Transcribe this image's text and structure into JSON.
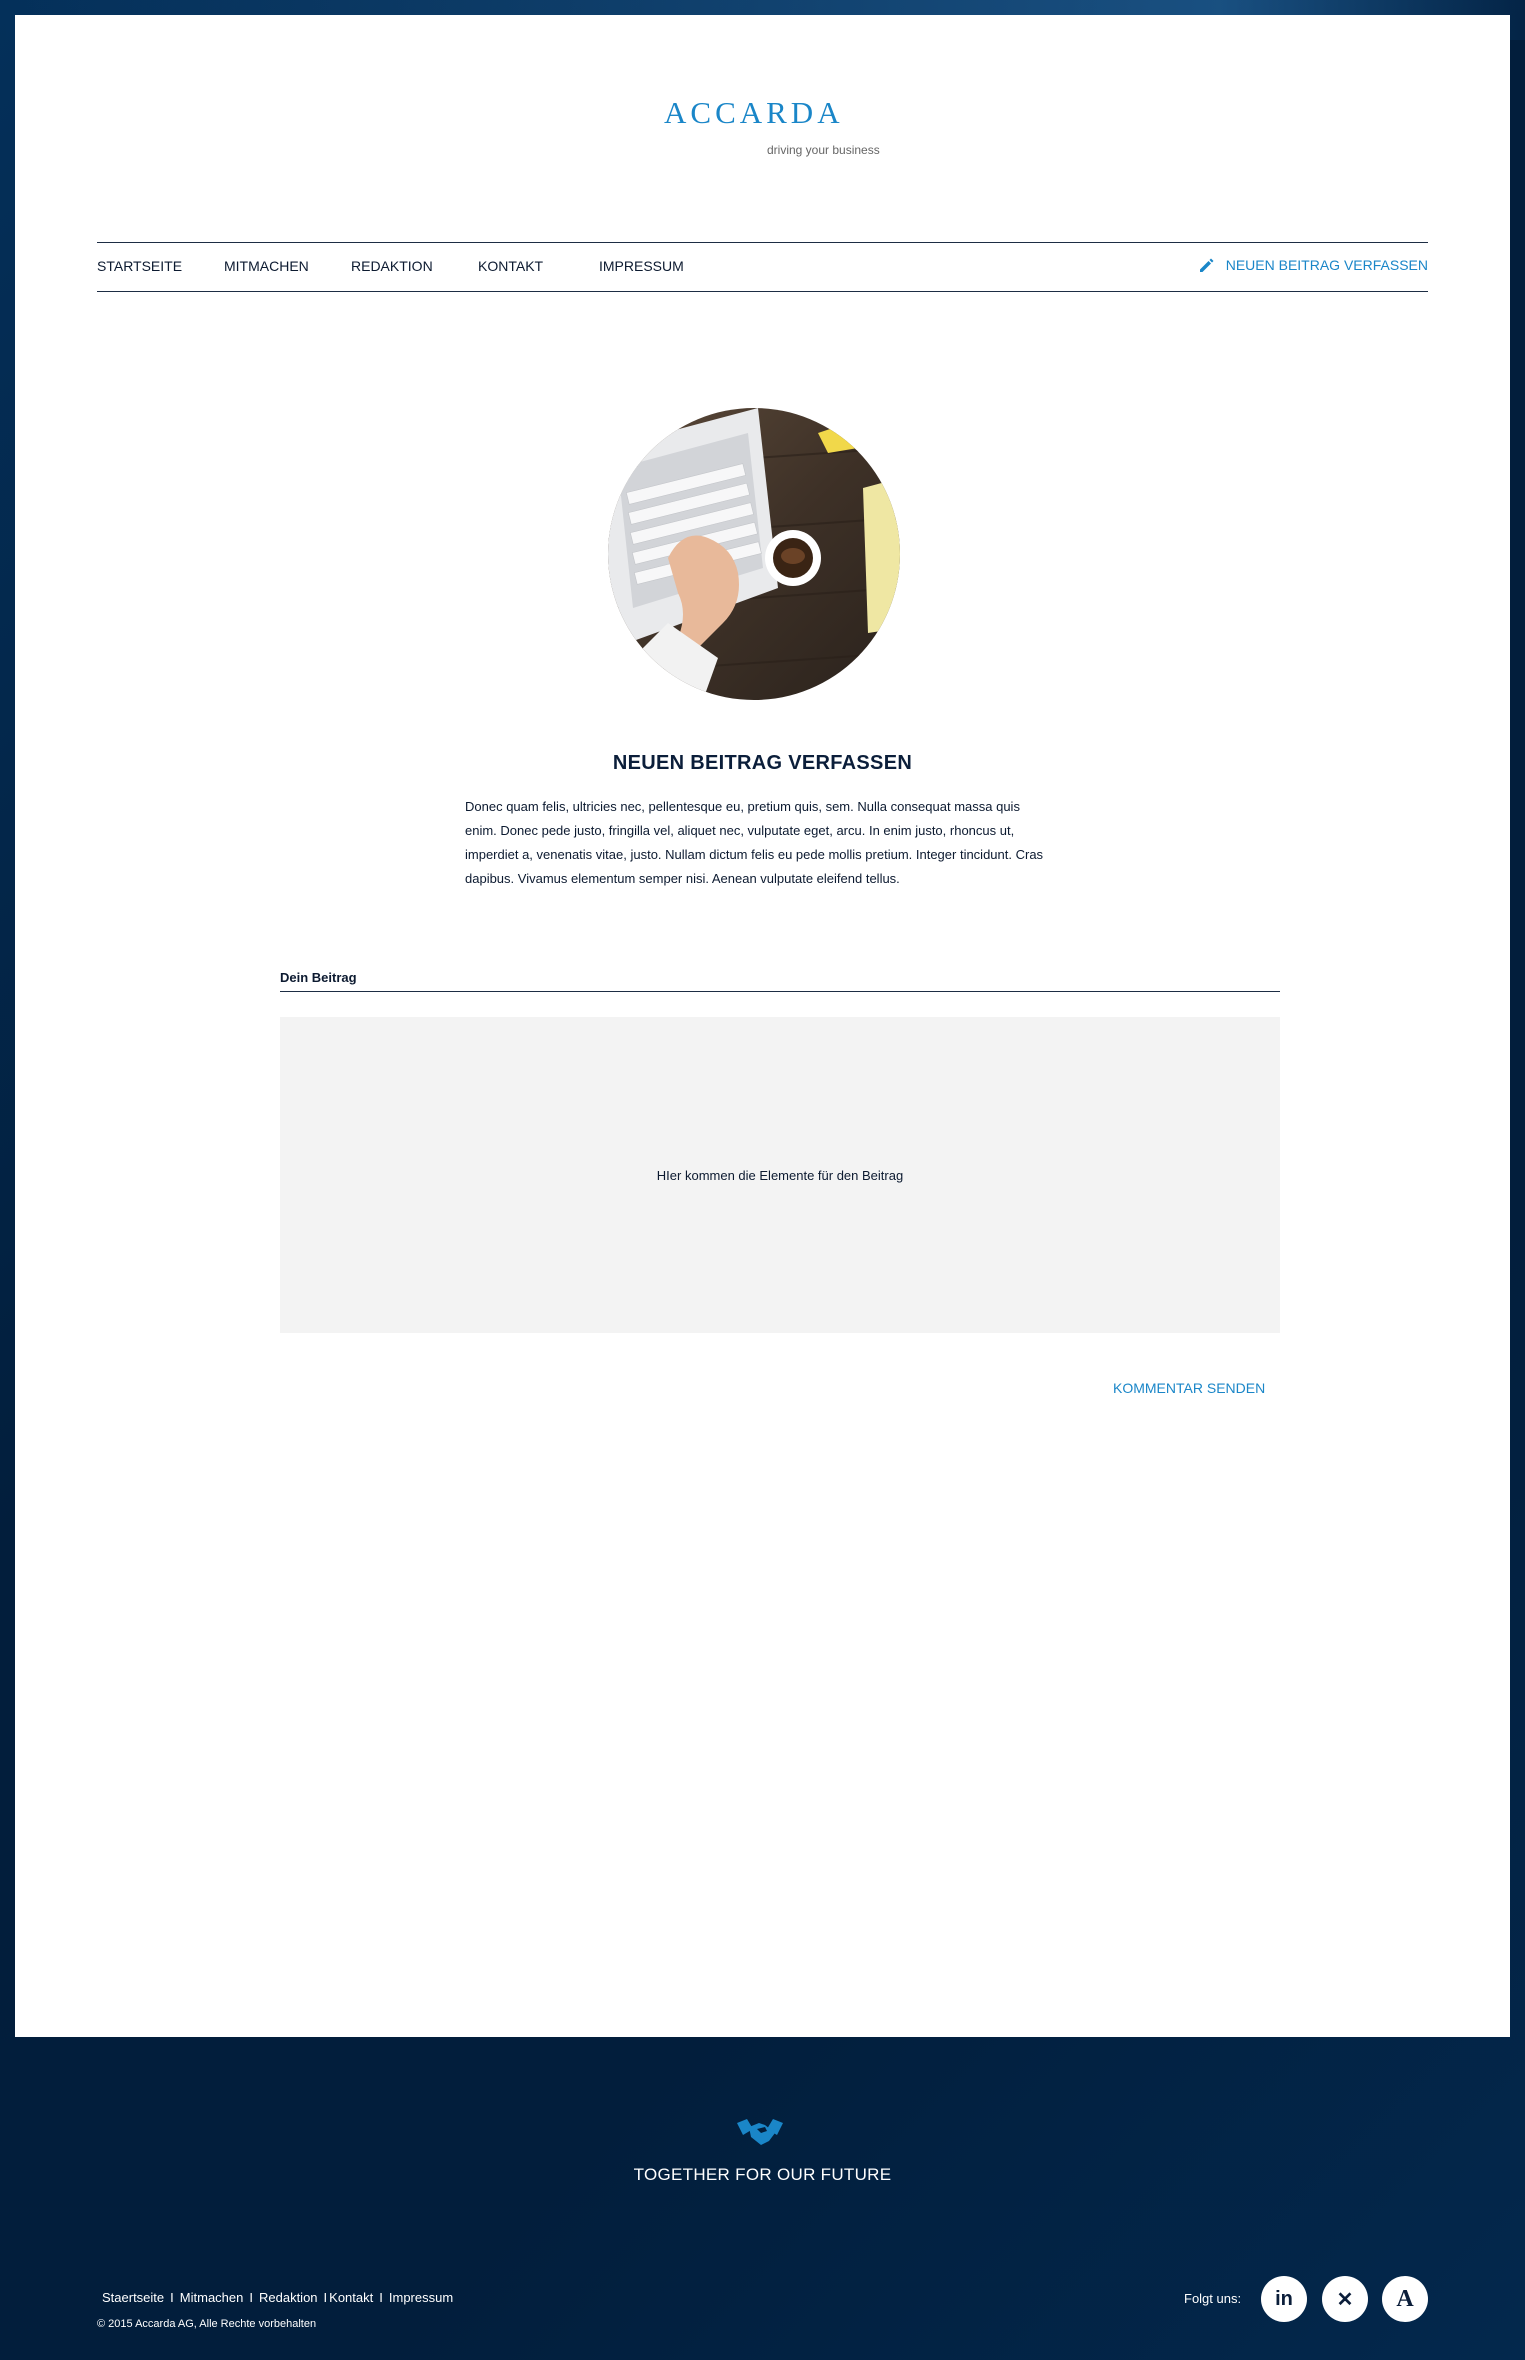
{
  "brand": {
    "name": "ACCARDA",
    "tagline": "driving your business"
  },
  "nav": {
    "items": [
      {
        "label": "STARTSEITE"
      },
      {
        "label": "MITMACHEN"
      },
      {
        "label": "REDAKTION"
      },
      {
        "label": "KONTAKT"
      },
      {
        "label": "IMPRESSUM"
      }
    ],
    "cta_label": "NEUEN BEITRAG VERFASSEN"
  },
  "main": {
    "title": "NEUEN BEITRAG VERFASSEN",
    "intro": "Donec quam felis, ultricies nec, pellentesque eu, pretium quis, sem. Nulla consequat massa quis enim. Donec pede justo, fringilla vel, aliquet nec, vulputate eget, arcu. In enim justo, rhoncus ut, imperdiet a, venenatis vitae, justo. Nullam dictum felis eu pede mollis pretium. Integer tincidunt. Cras dapibus. Vivamus elementum semper nisi. Aenean vulputate eleifend tellus.",
    "form_label": "Dein Beitrag",
    "placeholder_text": "HIer kommen die Elemente für den Beitrag",
    "submit_label": "KOMMENTAR SENDEN"
  },
  "footer": {
    "tagline": "TOGETHER FOR OUR FUTURE",
    "nav": [
      "Staertseite",
      "Mitmachen",
      "Redaktion",
      "Kontakt",
      "Impressum"
    ],
    "copyright": "© 2015 Accarda AG, Alle Rechte vorbehalten",
    "follow_label": "Folgt uns:",
    "social": [
      {
        "label": "in",
        "icon": "linkedin-icon"
      },
      {
        "label": "✕",
        "icon": "xing-icon"
      },
      {
        "label": "A",
        "icon": "accarda-icon"
      }
    ]
  },
  "colors": {
    "accent": "#1a86c8",
    "navy": "#0b1e3a",
    "background": "#021e3c"
  }
}
